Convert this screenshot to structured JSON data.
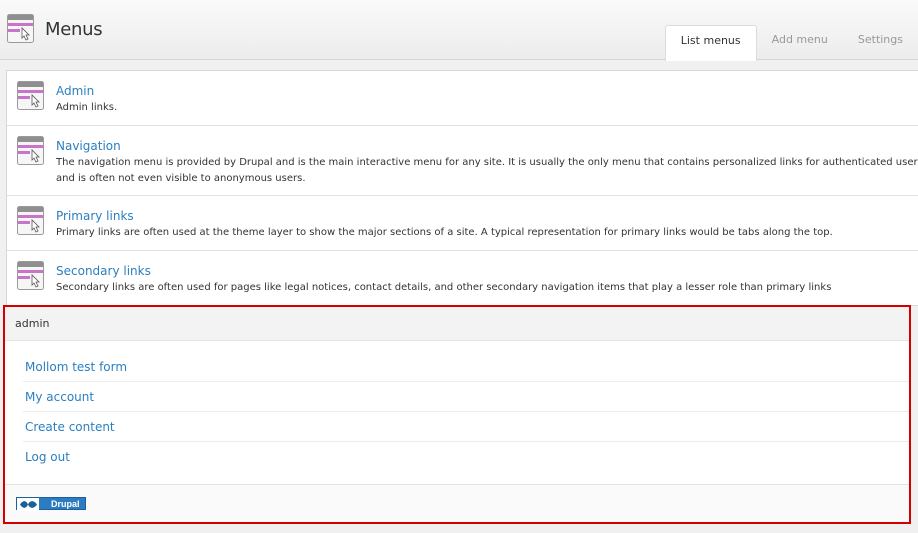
{
  "header": {
    "title": "Menus",
    "icon": "menu-window-icon"
  },
  "tabs": [
    {
      "label": "List menus",
      "active": true
    },
    {
      "label": "Add menu",
      "active": false
    },
    {
      "label": "Settings",
      "active": false
    }
  ],
  "menus": [
    {
      "name": "Admin",
      "description": "Admin links."
    },
    {
      "name": "Navigation",
      "description": "The navigation menu is provided by Drupal and is the main interactive menu for any site. It is usually the only menu that contains personalized links for authenticated users,",
      "description_line2": "and is often not even visible to anonymous users."
    },
    {
      "name": "Primary links",
      "description": "Primary links are often used at the theme layer to show the major sections of a site. A typical representation for primary links would be tabs along the top."
    },
    {
      "name": "Secondary links",
      "description": "Secondary links are often used for pages like legal notices, contact details, and other secondary navigation items that play a lesser role than primary links"
    }
  ],
  "admin_block": {
    "title": "admin",
    "links": [
      "Mollom test form",
      "My account",
      "Create content",
      "Log out"
    ]
  },
  "footer": {
    "badge_text": "Drupal"
  },
  "colors": {
    "link": "#2b7fc0",
    "highlight_border": "#d40000",
    "icon_accent": "#c774c9"
  }
}
